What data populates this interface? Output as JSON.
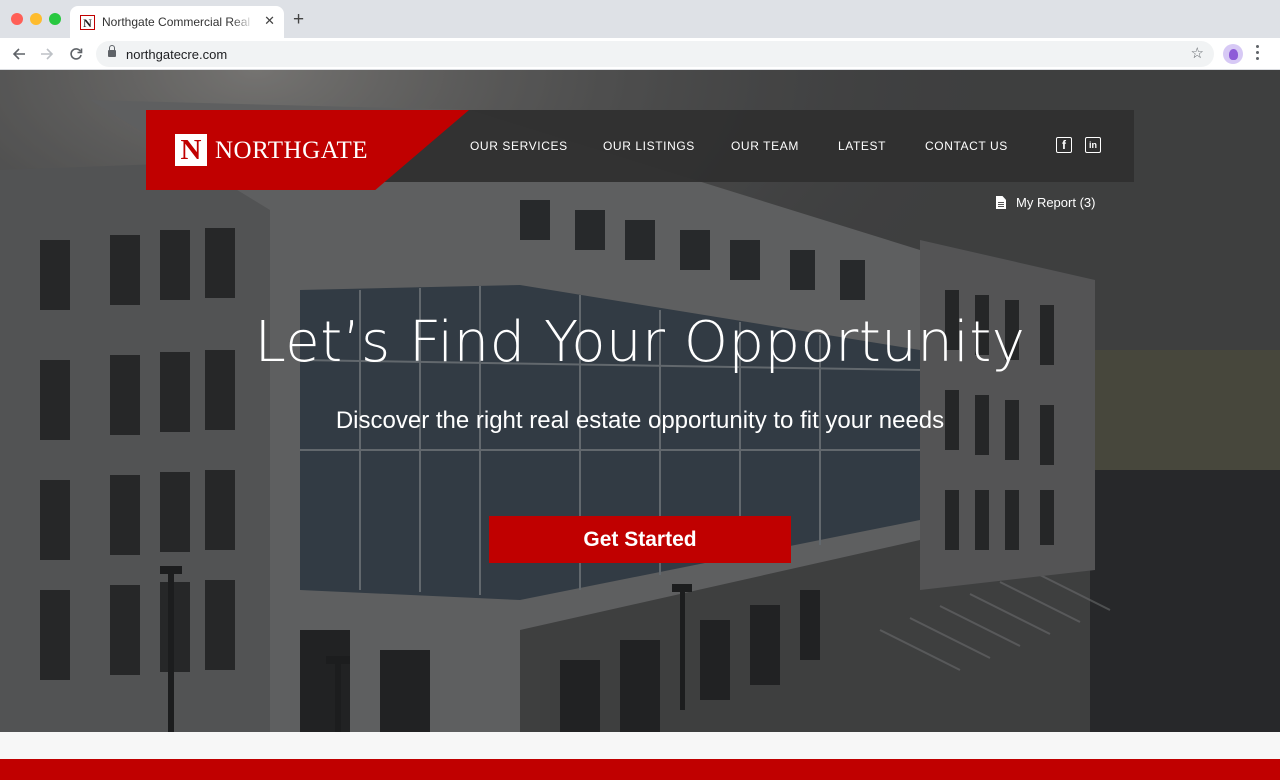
{
  "browser": {
    "tab_title": "Northgate Commercial Real Estate",
    "tab_favicon": "N",
    "url": "northgatecre.com",
    "icons": [
      "back-icon",
      "forward-icon",
      "reload-icon",
      "lock-icon",
      "star-icon",
      "profile-icon",
      "menu-icon"
    ]
  },
  "header": {
    "logo_mark": "N",
    "logo_text": "NORTHGATE",
    "nav": [
      {
        "label": "OUR SERVICES"
      },
      {
        "label": "OUR LISTINGS"
      },
      {
        "label": "OUR TEAM"
      },
      {
        "label": "LATEST"
      },
      {
        "label": "CONTACT US"
      }
    ],
    "social": {
      "facebook": "f",
      "linkedin": "in"
    }
  },
  "report": {
    "label": "My Report (3)"
  },
  "hero": {
    "headline": "Let’s Find Your Opportunity",
    "subheadline": "Discover the right real estate opportunity to fit your needs",
    "cta_label": "Get Started"
  },
  "colors": {
    "brand_red": "#c00000",
    "nav_bg": "#303030",
    "text": "#ffffff"
  }
}
